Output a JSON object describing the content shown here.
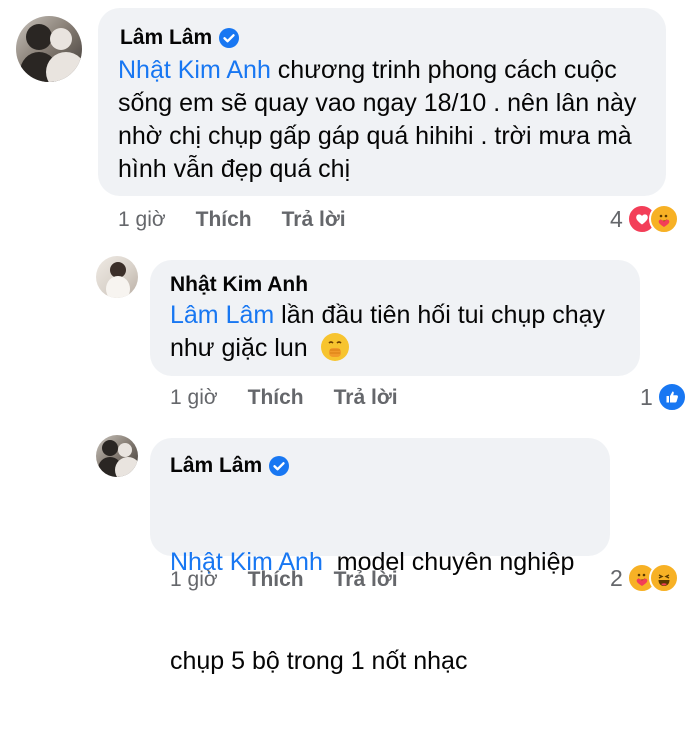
{
  "comment1": {
    "author": "Lâm Lâm",
    "verified": true,
    "mention": "Nhật Kim Anh",
    "lines": [
      " chương trinh phong cách cuộc",
      "sống em sẽ quay vao ngay 18/10 . nên lân này",
      "nhờ chị chụp gấp gáp quá hihihi . trời mưa mà",
      "hình vẫn đẹp quá chị"
    ],
    "time": "1 giờ",
    "like_label": "Thích",
    "reply_label": "Trả lời",
    "reaction_count": "4",
    "reactions": [
      "love-icon",
      "care-icon"
    ]
  },
  "reply1": {
    "author": "Nhật Kim Anh",
    "mention": "Lâm Lâm",
    "lines": [
      " lần đầu tiên hối tui chụp chạy",
      "như giặc lun"
    ],
    "emoji": "hand-over-mouth-emoji",
    "time": "1 giờ",
    "like_label": "Thích",
    "reply_label": "Trả lời",
    "reaction_count": "1",
    "reactions": [
      "like-icon"
    ]
  },
  "reply2": {
    "author": "Lâm Lâm",
    "verified": true,
    "mention": "Nhật Kim Anh",
    "lines": [
      "  model chuyên nghiệp",
      "chụp 5 bộ trong 1 nốt nhạc"
    ],
    "time": "1 giờ",
    "like_label": "Thích",
    "reply_label": "Trả lời",
    "reaction_count": "2",
    "reactions": [
      "care-icon",
      "haha-icon"
    ]
  },
  "colors": {
    "bubble": "#f0f2f5",
    "mention": "#1877f2",
    "meta": "#65676b",
    "verified": "#1877f2"
  }
}
